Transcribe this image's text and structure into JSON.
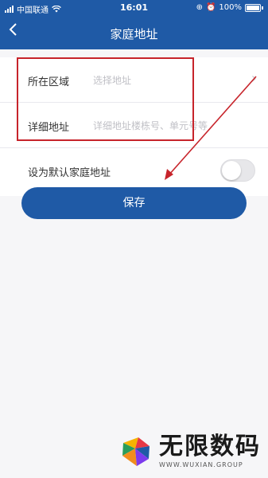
{
  "status_bar": {
    "carrier": "中国联通",
    "time": "16:01",
    "battery": "100%"
  },
  "nav": {
    "back_icon": "chevron-left-icon",
    "title": "家庭地址"
  },
  "form": {
    "region_label": "所在区域",
    "region_placeholder": "选择地址",
    "detail_label": "详细地址",
    "detail_placeholder": "详细地址楼栋号、单元号等",
    "default_label": "设为默认家庭地址",
    "default_on": false
  },
  "save_label": "保存",
  "colors": {
    "primary": "#1f5aa6",
    "annotation": "#c7242b"
  },
  "watermark": {
    "title": "无限数码",
    "subtitle": "WWW.WUXIAN.GROUP"
  }
}
